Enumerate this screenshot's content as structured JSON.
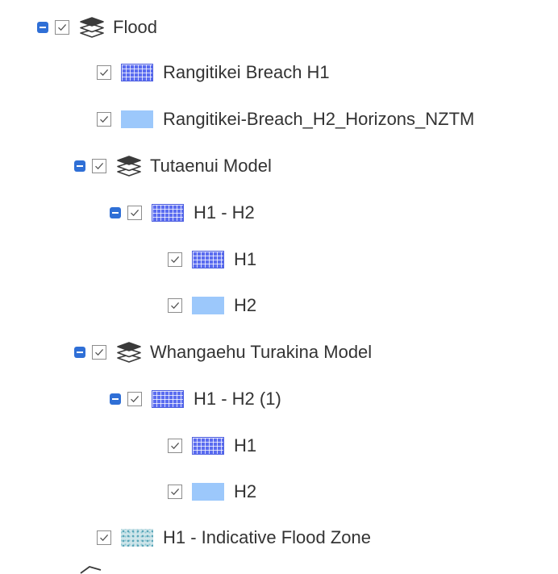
{
  "layers": {
    "flood": {
      "label": "Flood",
      "icon": "layers-group-icon",
      "checked": true
    },
    "rangitikei_h1": {
      "label": "Rangitikei Breach H1",
      "swatch": "grid-swatch-icon",
      "checked": true
    },
    "rangitikei_h2": {
      "label": "Rangitikei-Breach_H2_Horizons_NZTM",
      "swatch": "solid-swatch-icon",
      "checked": true
    },
    "tutaenui": {
      "label": "Tutaenui Model",
      "icon": "layers-group-icon",
      "checked": true
    },
    "tutaenui_h1h2": {
      "label": "H1 - H2",
      "swatch": "grid-swatch-icon",
      "checked": true
    },
    "tutaenui_h1": {
      "label": "H1",
      "swatch": "grid-swatch-icon",
      "checked": true
    },
    "tutaenui_h2": {
      "label": "H2",
      "swatch": "solid-swatch-icon",
      "checked": true
    },
    "whangaehu": {
      "label": "Whangaehu Turakina Model",
      "icon": "layers-group-icon",
      "checked": true
    },
    "whangaehu_h1h2": {
      "label": "H1 - H2 (1)",
      "swatch": "grid-swatch-icon",
      "checked": true
    },
    "whangaehu_h1": {
      "label": "H1",
      "swatch": "grid-swatch-icon",
      "checked": true
    },
    "whangaehu_h2": {
      "label": "H2",
      "swatch": "solid-swatch-icon",
      "checked": true
    },
    "indicative": {
      "label": "H1 - Indicative Flood Zone",
      "swatch": "dotted-swatch-icon",
      "checked": true
    }
  },
  "colors": {
    "collapse_button": "#2f6fd6",
    "grid_swatch": "#5a6cf0",
    "solid_swatch": "#9cc8fb",
    "dotted_swatch": "#cfe5ea",
    "text": "#333333"
  }
}
